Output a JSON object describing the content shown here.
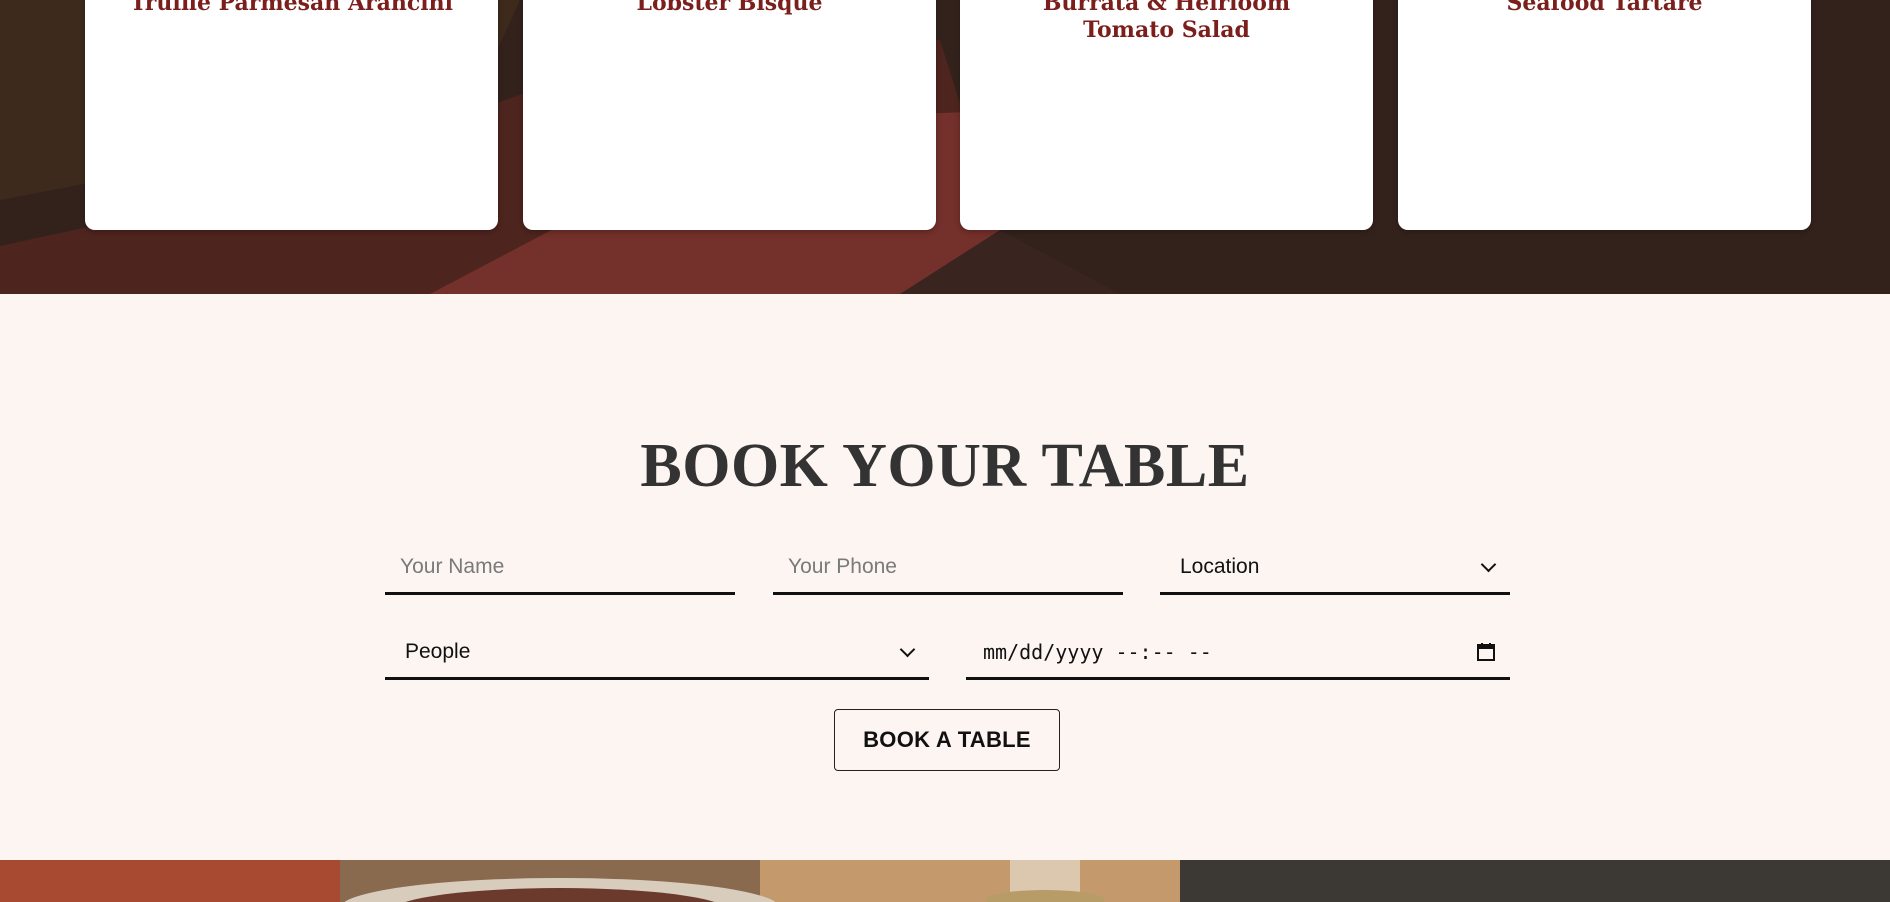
{
  "dishes": [
    {
      "name": "Truffle Parmesan Arancini"
    },
    {
      "name": "Lobster Bisque"
    },
    {
      "name": "Burrata & Heirloom Tomato Salad"
    },
    {
      "name": "Seafood Tartare"
    }
  ],
  "booking": {
    "title": "BOOK YOUR TABLE",
    "name_placeholder": "Your Name",
    "phone_placeholder": "Your Phone",
    "location_label": "Location",
    "people_label": "People",
    "datetime_placeholder": "mm/dd/yyyy --:-- --",
    "submit_label": "BOOK A TABLE"
  },
  "icons": {
    "location_chevron": "chevron-down-icon",
    "people_chevron": "chevron-down-icon",
    "datetime_picker": "calendar-icon"
  },
  "colors": {
    "dish_title": "#7b1f1c",
    "dishes_band_dark": "#33221c",
    "dishes_band_red": "#6e2a24",
    "booking_background": "#fcf5f1",
    "booking_title": "#333333"
  }
}
